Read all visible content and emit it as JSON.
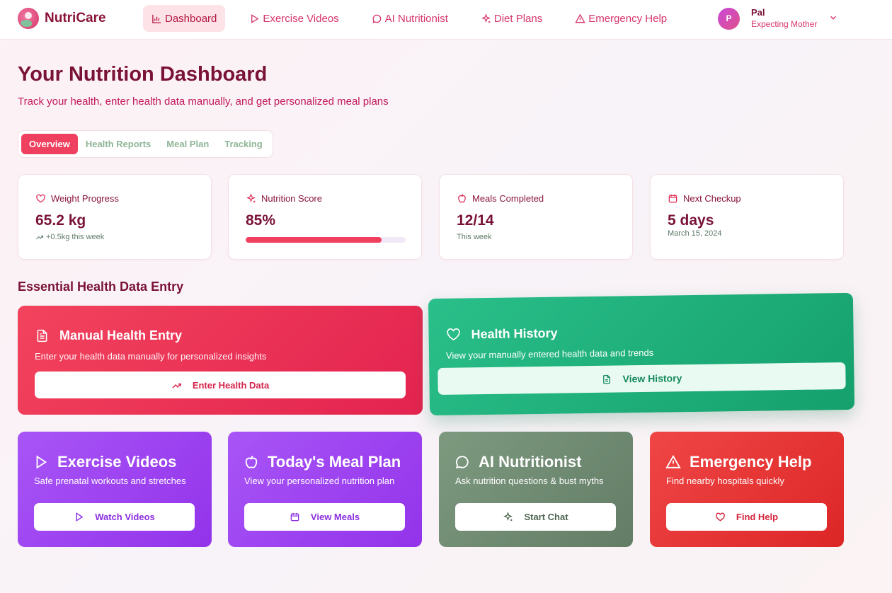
{
  "brand": {
    "name": "NutriCare"
  },
  "nav": {
    "items": [
      {
        "label": "Dashboard",
        "icon": "bar-chart-icon",
        "active": true
      },
      {
        "label": "Exercise Videos",
        "icon": "play-icon"
      },
      {
        "label": "AI Nutritionist",
        "icon": "chat-bubble-icon"
      },
      {
        "label": "Diet Plans",
        "icon": "sparkle-icon"
      },
      {
        "label": "Emergency Help",
        "icon": "warning-icon"
      }
    ]
  },
  "user": {
    "initial": "P",
    "name": "Pal",
    "role": "Expecting Mother"
  },
  "page": {
    "title": "Your Nutrition Dashboard",
    "subtitle": "Track your health, enter health data manually, and get personalized meal plans"
  },
  "tabs": [
    "Overview",
    "Health Reports",
    "Meal Plan",
    "Tracking"
  ],
  "stats": [
    {
      "label": "Weight Progress",
      "value": "65.2 kg",
      "note": "+0.5kg this week",
      "icon": "heart-icon"
    },
    {
      "label": "Nutrition Score",
      "value": "85%",
      "progress": 0.85,
      "icon": "sparkle-icon"
    },
    {
      "label": "Meals Completed",
      "value": "12/14",
      "note": "This week",
      "icon": "apple-icon"
    },
    {
      "label": "Next Checkup",
      "value": "5 days",
      "note": "March 15, 2024",
      "icon": "calendar-icon"
    }
  ],
  "section_title": "Essential Health Data Entry",
  "manual_entry": {
    "title": "Manual Health Entry",
    "description": "Enter your health data manually for personalized insights",
    "button": "Enter Health Data"
  },
  "health_history": {
    "title": "Health History",
    "description": "View your manually entered health data and trends",
    "button": "View History"
  },
  "quick_cards": [
    {
      "title": "Exercise Videos",
      "description": "Safe prenatal workouts and stretches",
      "button": "Watch Videos"
    },
    {
      "title": "Today's Meal Plan",
      "description": "View your personalized nutrition plan",
      "button": "View Meals"
    },
    {
      "title": "AI Nutritionist",
      "description": "Ask nutrition questions & bust myths",
      "button": "Start Chat"
    },
    {
      "title": "Emergency Help",
      "description": "Find nearby hospitals quickly",
      "button": "Find Help"
    }
  ],
  "colors": {
    "primary": "#f0405f",
    "brand_text": "#8a1538",
    "history_green": "#15a06d",
    "purple": "#9333ea",
    "sage": "#637c66",
    "emergency_red": "#dc2626"
  }
}
